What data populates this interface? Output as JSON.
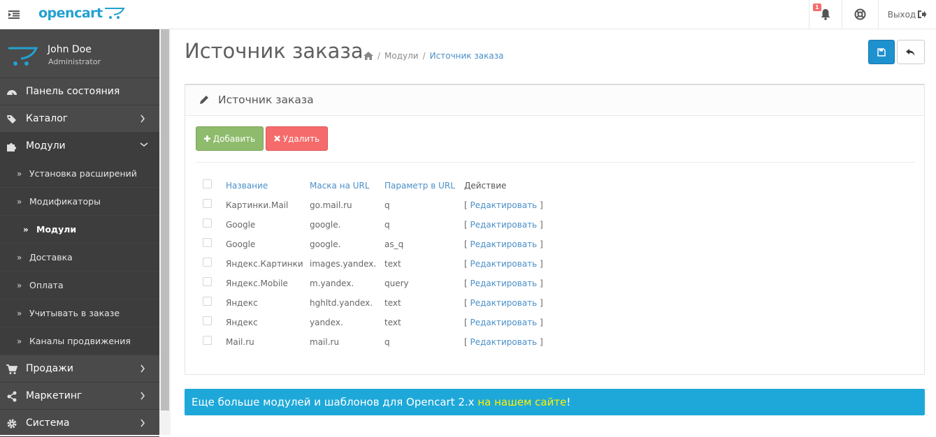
{
  "header": {
    "logo_text": "opencart",
    "notifications_count": "1",
    "logout_label": "Выход"
  },
  "profile": {
    "name": "John Doe",
    "role": "Administrator"
  },
  "sidebar": {
    "items": [
      {
        "label": "Панель состояния",
        "icon": "dashboard-icon"
      },
      {
        "label": "Каталог",
        "icon": "tags-icon"
      },
      {
        "label": "Модули",
        "icon": "puzzle-icon"
      },
      {
        "label": "Продажи",
        "icon": "cart-icon"
      },
      {
        "label": "Маркетинг",
        "icon": "share-icon"
      },
      {
        "label": "Система",
        "icon": "gear-icon"
      }
    ],
    "sub_items": [
      {
        "label": "Установка расширений"
      },
      {
        "label": "Модификаторы"
      },
      {
        "label": "Модули"
      },
      {
        "label": "Доставка"
      },
      {
        "label": "Оплата"
      },
      {
        "label": "Учитывать в заказе"
      },
      {
        "label": "Каналы продвижения"
      }
    ]
  },
  "page": {
    "title": "Источник заказа",
    "breadcrumb": [
      "Модули",
      "Источник заказа"
    ],
    "panel_title": "Источник заказа",
    "add_label": "Добавить",
    "delete_label": "Удалить"
  },
  "table": {
    "headers": [
      "Название",
      "Маска на URL",
      "Параметр в URL",
      "Действие"
    ],
    "edit_label": "Редактировать",
    "rows": [
      [
        "Картинки.Mail",
        "go.mail.ru",
        "q"
      ],
      [
        "Google",
        "google.",
        "q"
      ],
      [
        "Google",
        "google.",
        "as_q"
      ],
      [
        "Яндекс.Картинки",
        "images.yandex.",
        "text"
      ],
      [
        "Яндекс.Mobile",
        "m.yandex.",
        "query"
      ],
      [
        "Яндекс",
        "hghltd.yandex.",
        "text"
      ],
      [
        "Яндекс",
        "yandex.",
        "text"
      ],
      [
        "Mail.ru",
        "mail.ru",
        "q"
      ]
    ]
  },
  "banner": {
    "text": "Еще больше модулей и шаблонов для Opencart 2.x ",
    "link": "на нашем сайте",
    "suffix": "!"
  },
  "colors": {
    "accent": "#1e91cf",
    "sidebar_bg": "#4a4a4a",
    "add_green": "#8fbb6c",
    "delete_red": "#f56b6b",
    "banner_bg": "#1ea8d9",
    "link_blue": "#4a8fc9"
  }
}
